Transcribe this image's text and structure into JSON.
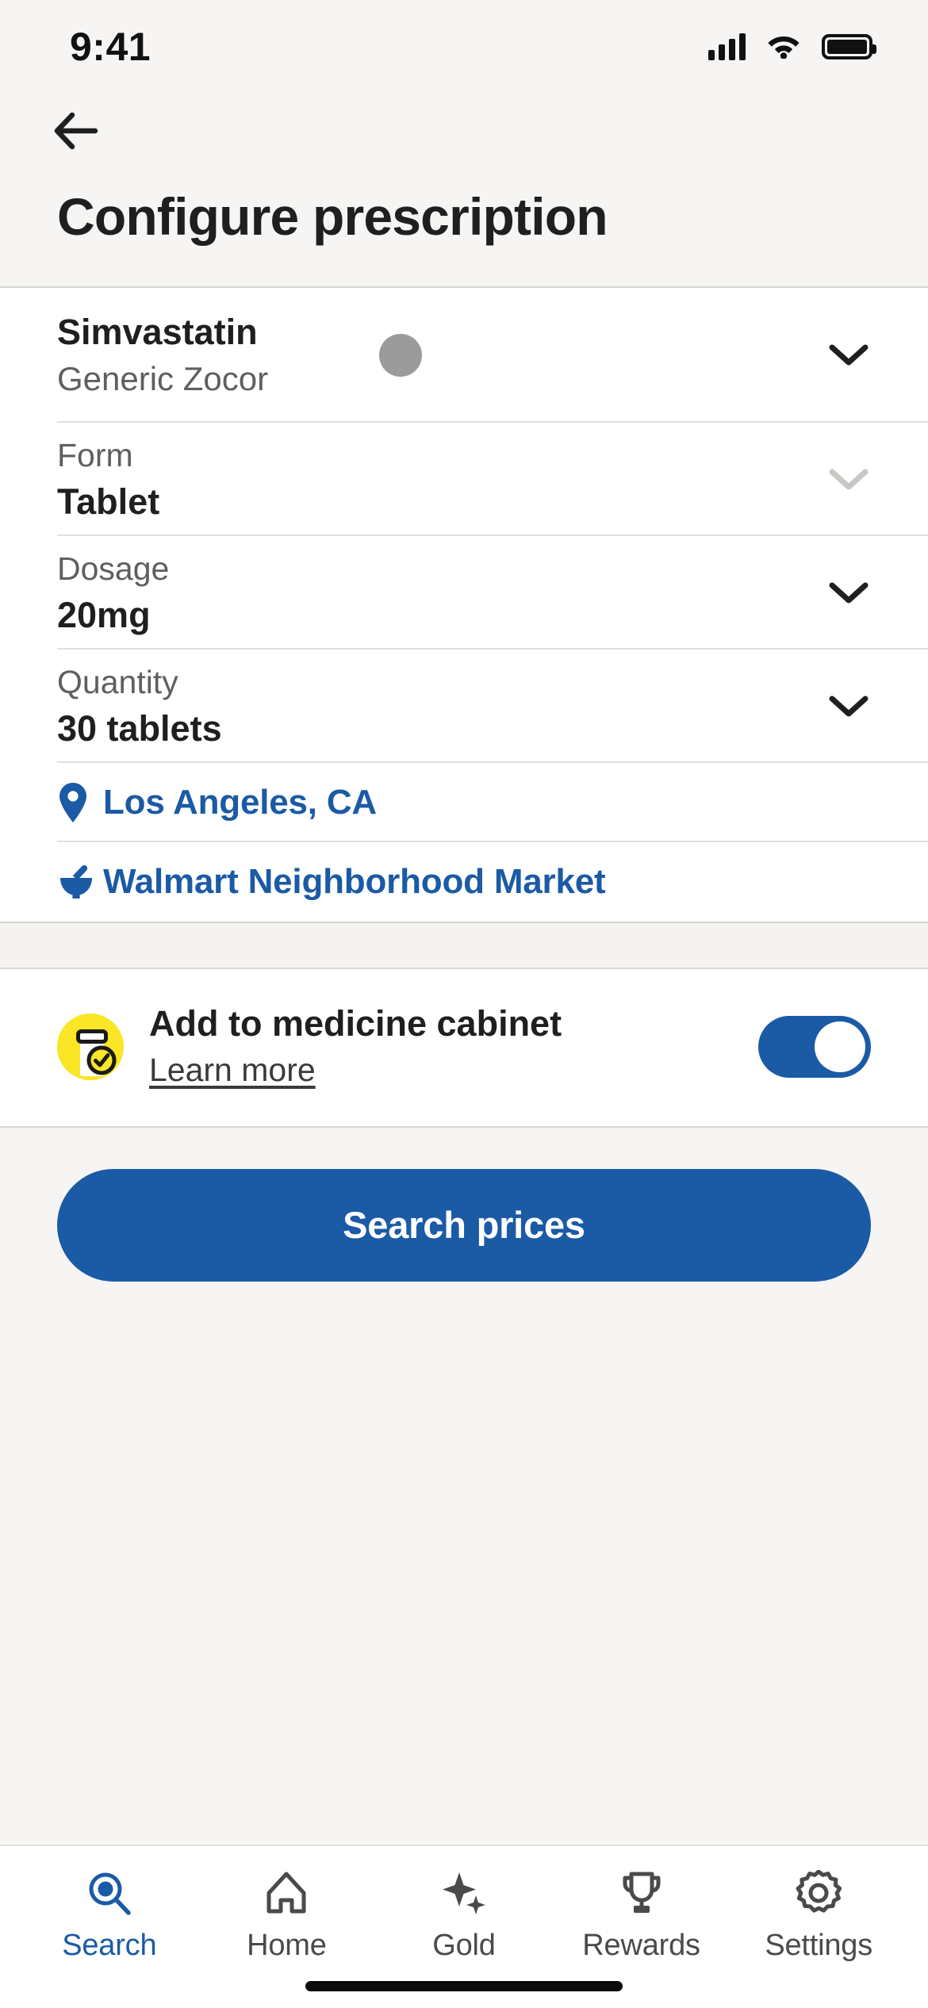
{
  "status_bar": {
    "time": "9:41",
    "signal_icon": "cellular-signal-icon",
    "wifi_icon": "wifi-icon",
    "battery_icon": "battery-icon"
  },
  "header": {
    "back_icon": "back-arrow-icon",
    "title": "Configure prescription"
  },
  "prescription": {
    "drug": {
      "name": "Simvastatin",
      "generic": "Generic Zocor",
      "shape_icon": "pill-shape-icon",
      "chevron_icon": "chevron-down-icon"
    },
    "fields": [
      {
        "label": "Form",
        "value": "Tablet",
        "chevron_icon": "chevron-down-icon",
        "disabled": true
      },
      {
        "label": "Dosage",
        "value": "20mg",
        "chevron_icon": "chevron-down-icon",
        "disabled": false
      },
      {
        "label": "Quantity",
        "value": "30 tablets",
        "chevron_icon": "chevron-down-icon",
        "disabled": false
      }
    ],
    "location": {
      "icon": "map-pin-icon",
      "label": "Los Angeles, CA"
    },
    "pharmacy": {
      "icon": "mortar-pestle-icon",
      "label": "Walmart Neighborhood Market"
    }
  },
  "medicine_cabinet": {
    "badge_icon": "pill-bottle-check-icon",
    "title": "Add to medicine cabinet",
    "learn_more": "Learn more",
    "toggle_state": "on"
  },
  "cta": {
    "label": "Search prices"
  },
  "tabbar": {
    "items": [
      {
        "label": "Search",
        "icon": "search-icon",
        "active": true
      },
      {
        "label": "Home",
        "icon": "home-icon",
        "active": false
      },
      {
        "label": "Gold",
        "icon": "sparkles-icon",
        "active": false
      },
      {
        "label": "Rewards",
        "icon": "trophy-icon",
        "active": false
      },
      {
        "label": "Settings",
        "icon": "gear-icon",
        "active": false
      }
    ]
  },
  "colors": {
    "brand_blue": "#1B5AA5",
    "badge_yellow": "#F8E627",
    "header_bg": "#F6F5F3",
    "text_dark": "#1F1F1F",
    "text_muted": "#5F5F5F",
    "divider": "#E2E0DC"
  }
}
